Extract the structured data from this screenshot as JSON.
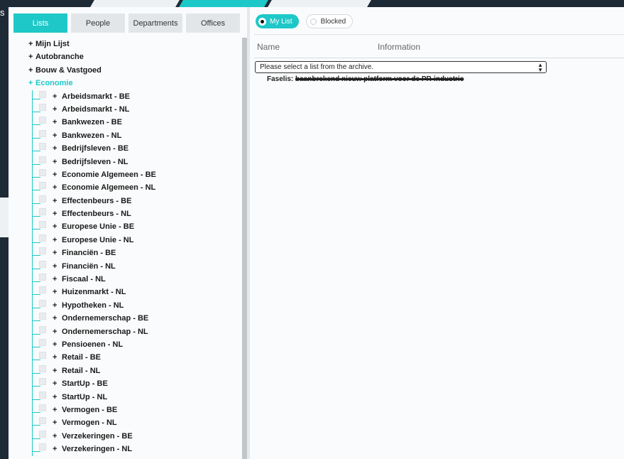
{
  "colors": {
    "accent": "#1ec8c8",
    "background_dark": "#1e2b36",
    "panel": "#fafbfc"
  },
  "header_glyph": "s",
  "tabs": [
    {
      "label": "Lists",
      "active": true
    },
    {
      "label": "People",
      "active": false
    },
    {
      "label": "Departments",
      "active": false
    },
    {
      "label": "Offices",
      "active": false
    }
  ],
  "tree": {
    "expand_symbol": "+",
    "roots": [
      {
        "label": "Mijn Lijst",
        "open": false
      },
      {
        "label": "Autobranche",
        "open": false
      },
      {
        "label": "Bouw & Vastgoed",
        "open": false
      },
      {
        "label": "Economie",
        "open": true
      }
    ],
    "economie_children": [
      "Arbeidsmarkt - BE",
      "Arbeidsmarkt - NL",
      "Bankwezen - BE",
      "Bankwezen - NL",
      "Bedrijfsleven - BE",
      "Bedrijfsleven - NL",
      "Economie Algemeen - BE",
      "Economie Algemeen - NL",
      "Effectenbeurs - BE",
      "Effectenbeurs - NL",
      "Europese Unie - BE",
      "Europese Unie - NL",
      "Financiën - BE",
      "Financiën - NL",
      "Fiscaal - NL",
      "Huizenmarkt - NL",
      "Hypotheken - NL",
      "Ondernemerschap - BE",
      "Ondernemerschap - NL",
      "Pensioenen - NL",
      "Retail - BE",
      "Retail - NL",
      "StartUp - BE",
      "StartUp - NL",
      "Vermogen - BE",
      "Vermogen - NL",
      "Verzekeringen - BE",
      "Verzekeringen - NL"
    ]
  },
  "right": {
    "toggles": [
      {
        "label": "My List",
        "active": true
      },
      {
        "label": "Blocked",
        "active": false
      }
    ],
    "columns": {
      "name": "Name",
      "information": "Information"
    },
    "select_placeholder": "Please select a list from the archive.",
    "faselis_prefix": "Faselis:",
    "faselis_text": "baanbrekend nieuw platform voor de PR-industrie"
  }
}
